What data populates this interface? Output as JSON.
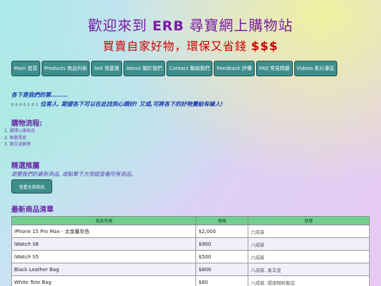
{
  "hero": {
    "title_pre": "歡迎來到 ",
    "title_brand": "ERB",
    "title_post": " 尋寶網上購物站",
    "subtitle": "買賣自家好物，環保又省錢 ",
    "subtitle_money": "$$$"
  },
  "nav": [
    {
      "label": "Main 首頁"
    },
    {
      "label": "Products 商品列表"
    },
    {
      "label": "Sell 我要賣"
    },
    {
      "label": "About 關於我們"
    },
    {
      "label": "Contact 聯絡我們"
    },
    {
      "label": "Feedback 評價"
    },
    {
      "label": "FAQ 常見問題"
    },
    {
      "label": "Videos 影片專區"
    }
  ],
  "intro": {
    "line1": "各下是我們的第........",
    "counter": "0 0 0 0 1 0 1",
    "line2": "位客人. 期望各下可以在此找到心頭好! 又或,可將各下的好物賣給有緣人!"
  },
  "process": {
    "heading": "購物流程:",
    "steps": [
      "選擇心儀商品",
      "聯繫賣家",
      "面交或郵寄"
    ]
  },
  "featured": {
    "heading": "精選推薦",
    "description": "瀏覽我們的最新商品, 或點擊下方按鈕查看所有商品。",
    "button": "查看全部商品"
  },
  "products": {
    "heading": "最新商品清單",
    "columns": [
      "商品名稱",
      "價格",
      "狀態"
    ],
    "rows": [
      {
        "name": "iPhone 15 Pro Max - 太金屬灰色",
        "price": "$2,000",
        "state": "六成新"
      },
      {
        "name": "iWatch S6",
        "price": "$900",
        "state": "八成新"
      },
      {
        "name": "iWatch S5",
        "price": "$500",
        "state": "六成新"
      },
      {
        "name": "Black Leather Bag",
        "price": "$800",
        "state": "八成新, 真羊皮"
      },
      {
        "name": "White Tote Bag",
        "price": "$80",
        "state": "八成新, 環保物料製造"
      }
    ]
  }
}
